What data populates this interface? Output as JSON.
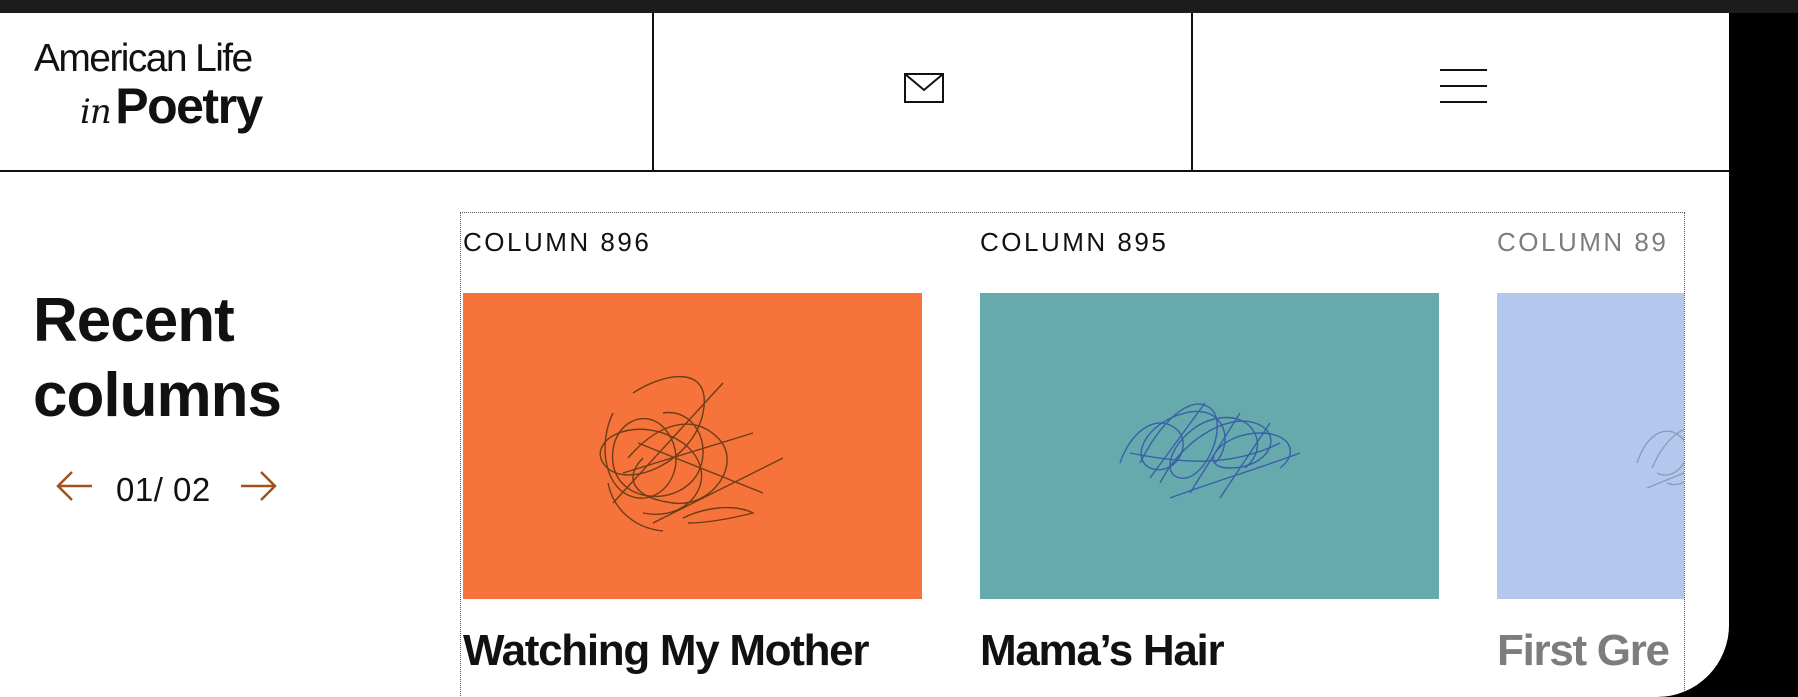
{
  "header": {
    "logo_line1": "American Life",
    "logo_in": "in",
    "logo_poetry": "Poetry",
    "mail_icon": "mail-icon",
    "menu_icon": "hamburger-menu-icon"
  },
  "section": {
    "title": "Recent columns",
    "pager": {
      "current": "01",
      "total": "02",
      "text": "01/ 02"
    }
  },
  "columns": [
    {
      "label": "COLUMN 896",
      "title": "Watching My Mother",
      "image_color": "#f7733c",
      "scribble_color": "#6b3e14"
    },
    {
      "label": "COLUMN 895",
      "title": "Mama’s Hair",
      "image_color": "#66aaad",
      "scribble_color": "#3a5fa8"
    },
    {
      "label": "COLUMN 89",
      "title": "First Gre",
      "image_color": "#b4c7ec",
      "scribble_color": "#8a9ab8"
    }
  ],
  "colors": {
    "accent": "#a0521e",
    "text": "#111111",
    "frame": "#000000"
  }
}
